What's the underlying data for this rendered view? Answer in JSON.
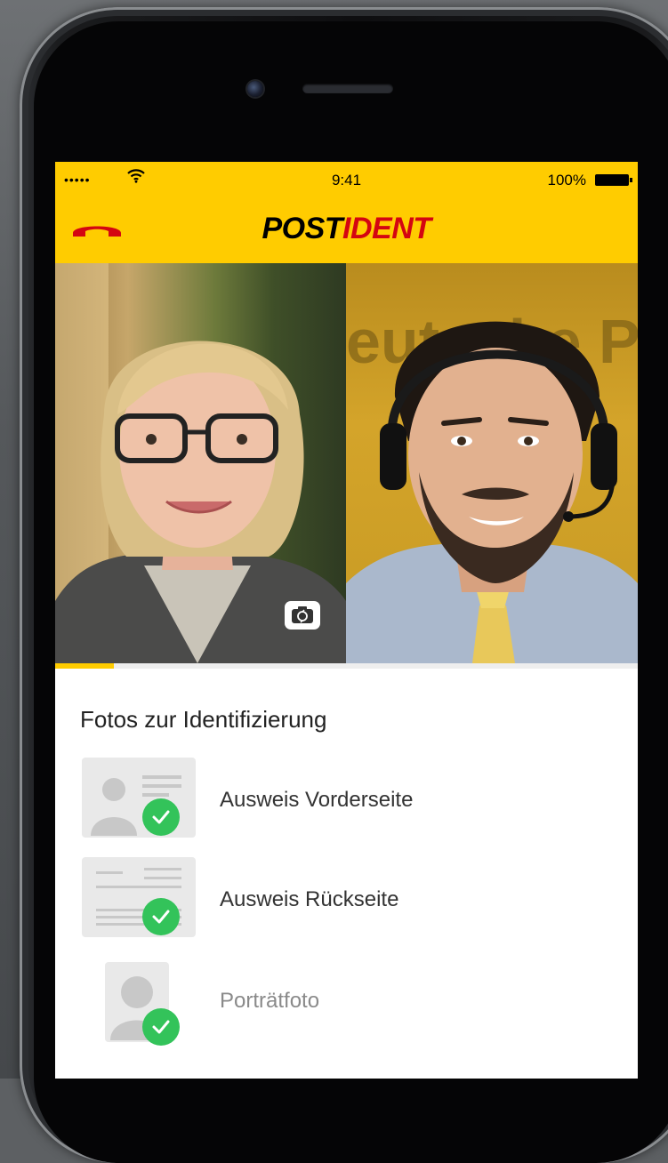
{
  "status_bar": {
    "signal": "•••••",
    "time": "9:41",
    "battery_percent": "100%",
    "wifi_icon": "wifi-icon",
    "battery_icon": "battery-full-icon"
  },
  "navbar": {
    "hangup_icon": "phone-hangup-icon",
    "logo_part1": "POST",
    "logo_part2": "IDENT",
    "brand_color": "#ffcc00",
    "accent_color": "#d40511"
  },
  "video": {
    "self_view": "self-camera-view",
    "agent_view": "agent-video-view",
    "background_text": "eutsche P",
    "switch_camera_icon": "camera-switch-icon",
    "progress_fraction": 0.1
  },
  "identification": {
    "title": "Fotos zur Identifizierung",
    "items": [
      {
        "label": "Ausweis Vorderseite",
        "icon": "id-card-front-icon",
        "status": "complete"
      },
      {
        "label": "Ausweis Rückseite",
        "icon": "id-card-back-icon",
        "status": "complete"
      },
      {
        "label": "Porträtfoto",
        "icon": "portrait-photo-icon",
        "status": "complete"
      }
    ],
    "check_color": "#33c35a"
  }
}
